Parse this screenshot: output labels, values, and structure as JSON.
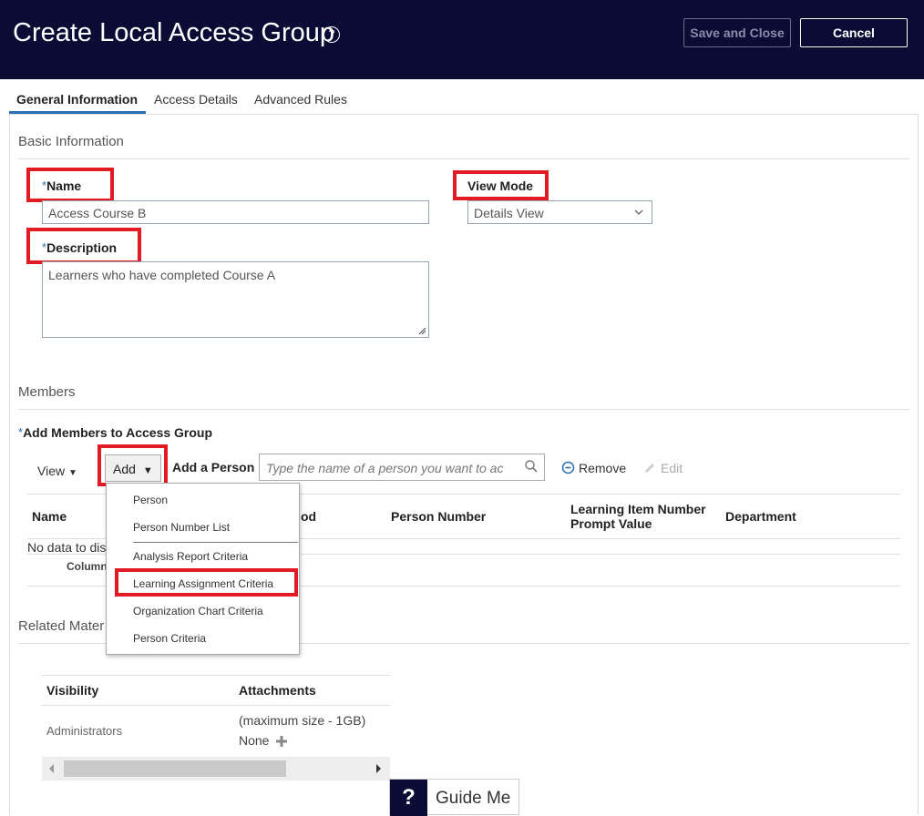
{
  "header": {
    "title": "Create Local Access Group",
    "save_label": "Save and Close",
    "cancel_label": "Cancel"
  },
  "tabs": [
    {
      "label": "General Information",
      "active": true
    },
    {
      "label": "Access Details",
      "active": false
    },
    {
      "label": "Advanced Rules",
      "active": false
    }
  ],
  "basic_info": {
    "section_title": "Basic Information",
    "name_label": "Name",
    "name_value": "Access Course B",
    "description_label": "Description",
    "description_value": "Learners who have completed Course A",
    "view_mode_label": "View Mode",
    "view_mode_value": "Details View"
  },
  "members": {
    "section_title": "Members",
    "add_members_label": "Add Members to Access Group",
    "view_label": "View",
    "add_label": "Add",
    "add_person_label": "Add a Person",
    "person_placeholder": "Type the name of a person you want to ac",
    "remove_label": "Remove",
    "edit_label": "Edit",
    "columns": {
      "name": "Name",
      "method_fragment": "od",
      "person_number": "Person Number",
      "learning_item_line1": "Learning Item Number",
      "learning_item_line2": "Prompt Value",
      "department": "Department"
    },
    "no_data_fragment": "No data to dis",
    "columns_fragment": "Column"
  },
  "add_menu": {
    "items": [
      "Person",
      "Person Number List",
      "Analysis Report Criteria",
      "Learning Assignment Criteria",
      "Organization Chart Criteria",
      "Person Criteria"
    ]
  },
  "related": {
    "section_title_fragment": "Related Mater",
    "col_visibility": "Visibility",
    "col_attachments": "Attachments",
    "row_visibility": "Administrators",
    "max_size": "(maximum size - 1GB)",
    "none_label": "None"
  },
  "guide": {
    "q": "?",
    "label": "Guide Me"
  },
  "colors": {
    "header_bg": "#0b0c35",
    "highlight": "#e01b24",
    "accent": "#2a6fb5"
  }
}
